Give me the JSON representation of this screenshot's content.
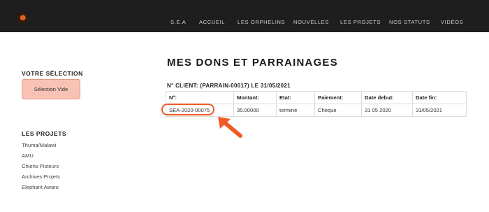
{
  "nav": [
    "S.E.A",
    "ACCUEIL",
    "LES ORPHELINS",
    "NOUVELLES",
    "LES PROJETS",
    "NOS STATUTS",
    "VIDÉOS"
  ],
  "sidebar": {
    "selection_title": "VOTRE SÉLECTION",
    "selection_empty": "Sélection Vide",
    "projects_title": "LES PROJETS",
    "projects": [
      "Thuma/Malawi",
      "AMU",
      "Chiens Pisteurs",
      "Archives Projets",
      "Elephant Aware"
    ]
  },
  "main": {
    "title": "MES DONS ET PARRAINAGES",
    "client_line": "N° CLIENT: (PARRAIN-00017) LE 31/05/2021",
    "table": {
      "headers": [
        "N°:",
        "Montant:",
        "Etat:",
        "Paiement:",
        "Date debut:",
        "Date fin:"
      ],
      "rows": [
        [
          "SEA-2020-00075",
          "35.00000",
          "terminé",
          "Chèque",
          "31 05 2020",
          "31/05/2021"
        ]
      ]
    }
  },
  "colors": {
    "topbar": "#1e1e1e",
    "accent": "#f15a24",
    "selection_bg": "#f8c3b5"
  },
  "icons": {
    "logo": "sea-logo-icon",
    "annotation_arrow": "arrow-icon"
  }
}
